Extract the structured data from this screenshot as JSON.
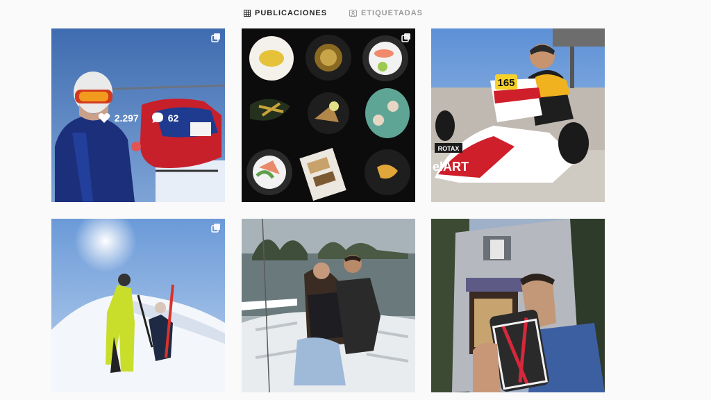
{
  "tabs": {
    "posts": {
      "label": "PUBLICACIONES",
      "icon": "grid-icon",
      "active": true
    },
    "tagged": {
      "label": "ETIQUETADAS",
      "icon": "tag-icon",
      "active": false
    }
  },
  "posts": [
    {
      "id": "post-1",
      "subject": "heli-ski",
      "multi": true,
      "likes": "2.297",
      "comments": "62"
    },
    {
      "id": "post-2",
      "subject": "food-plates",
      "multi": true
    },
    {
      "id": "post-3",
      "subject": "kart",
      "multi": false,
      "kart_number": "165",
      "kart_brand": "elART",
      "kart_sponsor": "ROTAX"
    },
    {
      "id": "post-4",
      "subject": "ski-mountain",
      "multi": true
    },
    {
      "id": "post-5",
      "subject": "boat-couple",
      "multi": false
    },
    {
      "id": "post-6",
      "subject": "selfie-street",
      "multi": false
    }
  ],
  "colors": {
    "active_tab": "#262626",
    "inactive_tab": "#9a9a9a",
    "background": "#fafafa"
  }
}
